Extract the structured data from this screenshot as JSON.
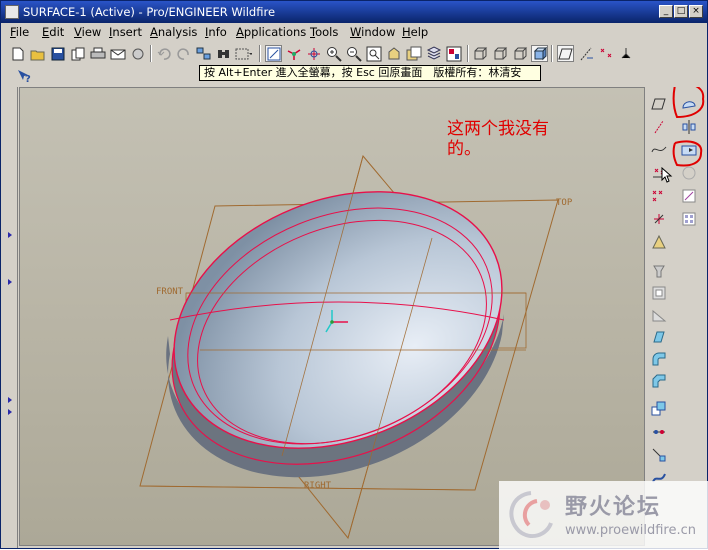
{
  "window": {
    "title": "SURFACE-1 (Active) - Pro/ENGINEER Wildfire",
    "minimize_glyph": "_",
    "maximize_glyph": "□",
    "close_glyph": "×"
  },
  "menu": [
    {
      "accel": "F",
      "rest": "ile"
    },
    {
      "accel": "E",
      "rest": "dit"
    },
    {
      "accel": "V",
      "rest": "iew"
    },
    {
      "accel": "I",
      "rest": "nsert"
    },
    {
      "accel": "A",
      "rest": "nalysis"
    },
    {
      "accel": "I",
      "rest": "nfo",
      "prefix": ""
    },
    {
      "accel": "A",
      "rest": "pplications"
    },
    {
      "accel": "T",
      "rest": "ools"
    },
    {
      "accel": "W",
      "rest": "indow"
    },
    {
      "accel": "H",
      "rest": "elp"
    }
  ],
  "tooltip": "按 Alt+Enter 進入全螢幕，按 Esc 回原畫面　版權所有：林清安",
  "annotation": {
    "line1": "这两个我没有",
    "line2": "的。",
    "color": "#e00000"
  },
  "datum_planes": {
    "top": "TOP",
    "front": "FRONT",
    "right": "RIGHT"
  },
  "watermark": {
    "name": "野火论坛",
    "url": "www.proewildfire.cn"
  },
  "colors": {
    "title_bar": "#0a246a",
    "viewport": "#bab6a7",
    "datum": "#a06a30",
    "edge": "#e8104a",
    "highlight_marker": "#e00000"
  }
}
